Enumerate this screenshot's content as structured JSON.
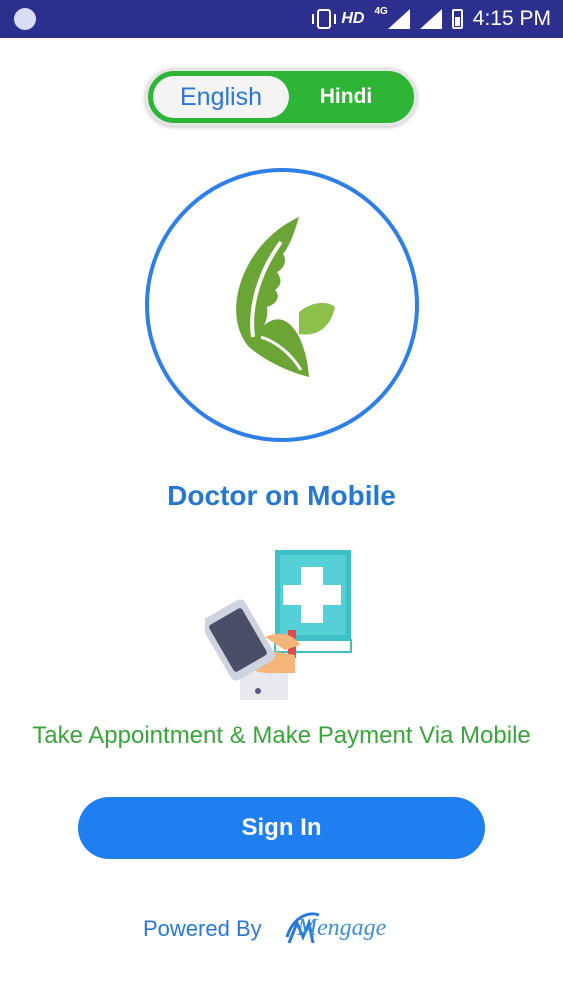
{
  "status_bar": {
    "network_label": "HD",
    "network_type": "4G",
    "time": "4:15 PM"
  },
  "language_toggle": {
    "english_label": "English",
    "hindi_label": "Hindi",
    "selected": "English"
  },
  "app": {
    "title": "Doctor on Mobile",
    "tagline": "Take Appointment & Make Payment Via Mobile"
  },
  "signin": {
    "label": "Sign In"
  },
  "footer": {
    "powered_by": "Powered By",
    "brand": "Mengage"
  },
  "colors": {
    "status_bar": "#2d2f8f",
    "toggle_green": "#2fb536",
    "accent_blue": "#1f7ef0",
    "tagline_green": "#3aa53a"
  }
}
